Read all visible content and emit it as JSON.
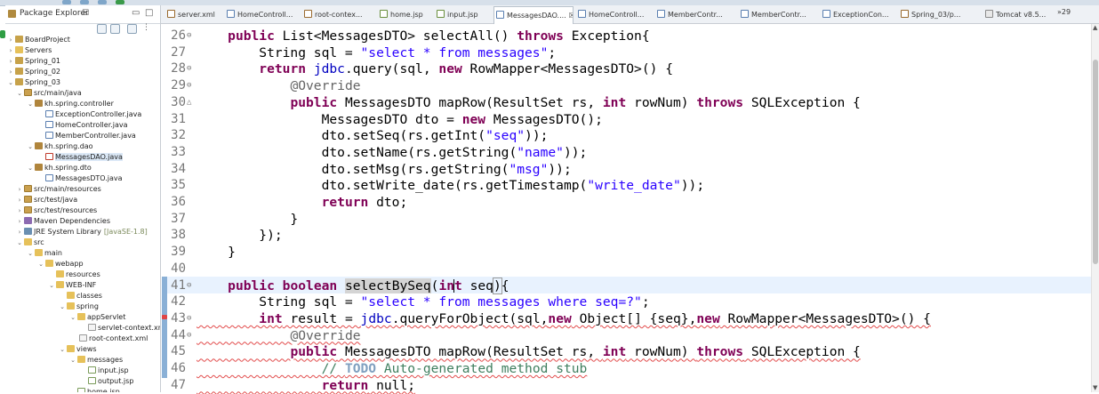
{
  "explorer": {
    "title": "Package Explorer",
    "close_glyph": "☒",
    "tree": [
      {
        "label": "BoardProject",
        "icon": "project-icon",
        "expanded": false
      },
      {
        "label": "Servers",
        "icon": "folder-icon",
        "expanded": false
      },
      {
        "label": "Spring_01",
        "icon": "project-icon",
        "expanded": false
      },
      {
        "label": "Spring_02",
        "icon": "project-icon",
        "expanded": false
      },
      {
        "label": "Spring_03",
        "icon": "project-icon",
        "expanded": true
      },
      {
        "label": "src/main/java",
        "icon": "source-folder-icon",
        "expanded": true
      },
      {
        "label": "kh.spring.controller",
        "icon": "package-icon",
        "expanded": true
      },
      {
        "label": "ExceptionController.java",
        "icon": "java-file-icon"
      },
      {
        "label": "HomeController.java",
        "icon": "java-file-icon"
      },
      {
        "label": "MemberController.java",
        "icon": "java-file-icon"
      },
      {
        "label": "kh.spring.dao",
        "icon": "package-icon",
        "expanded": true
      },
      {
        "label": "MessagesDAO.java",
        "icon": "java-file-icon",
        "selected": true
      },
      {
        "label": "kh.spring.dto",
        "icon": "package-icon",
        "expanded": true
      },
      {
        "label": "MessagesDTO.java",
        "icon": "java-file-icon"
      },
      {
        "label": "src/main/resources",
        "icon": "source-folder-icon",
        "expanded": false
      },
      {
        "label": "src/test/java",
        "icon": "source-folder-icon",
        "expanded": false
      },
      {
        "label": "src/test/resources",
        "icon": "source-folder-icon",
        "expanded": false
      },
      {
        "label": "Maven Dependencies",
        "icon": "library-icon",
        "expanded": false
      },
      {
        "label": "JRE System Library",
        "decoration": "[JavaSE-1.8]",
        "icon": "jre-icon",
        "expanded": false
      },
      {
        "label": "src",
        "icon": "folder-icon",
        "expanded": true
      },
      {
        "label": "main",
        "icon": "folder-icon",
        "expanded": true
      },
      {
        "label": "webapp",
        "icon": "folder-icon",
        "expanded": true
      },
      {
        "label": "resources",
        "icon": "folder-icon"
      },
      {
        "label": "WEB-INF",
        "icon": "folder-icon",
        "expanded": true
      },
      {
        "label": "classes",
        "icon": "folder-icon"
      },
      {
        "label": "spring",
        "icon": "folder-icon",
        "expanded": true
      },
      {
        "label": "appServlet",
        "icon": "folder-icon",
        "expanded": true
      },
      {
        "label": "servlet-context.xn",
        "icon": "xml-file-icon"
      },
      {
        "label": "root-context.xml",
        "icon": "xml-file-icon"
      },
      {
        "label": "views",
        "icon": "folder-icon",
        "expanded": true
      },
      {
        "label": "messages",
        "icon": "folder-icon",
        "expanded": true
      },
      {
        "label": "input.jsp",
        "icon": "jsp-file-icon"
      },
      {
        "label": "output.jsp",
        "icon": "jsp-file-icon"
      },
      {
        "label": "home.jsp",
        "icon": "jsp-file-icon"
      }
    ]
  },
  "tabs": [
    {
      "label": "server.xml",
      "icon": "xml"
    },
    {
      "label": "HomeControll...",
      "icon": "java"
    },
    {
      "label": "root-contex...",
      "icon": "xml"
    },
    {
      "label": "home.jsp",
      "icon": "jsp"
    },
    {
      "label": "input.jsp",
      "icon": "jsp"
    },
    {
      "label": "MessagesDAO....",
      "icon": "java",
      "active": true,
      "close_glyph": "☒"
    },
    {
      "label": "HomeControll...",
      "icon": "java"
    },
    {
      "label": "MemberContr...",
      "icon": "java"
    },
    {
      "label": "MemberContr...",
      "icon": "java"
    },
    {
      "label": "ExceptionCon...",
      "icon": "java"
    },
    {
      "label": "Spring_03/p...",
      "icon": "xml"
    },
    {
      "label": "Tomcat v8.5...",
      "icon": "tomcat"
    }
  ],
  "tab_overflow": "»29",
  "editor": {
    "current_line": 41,
    "lines": [
      {
        "n": 26,
        "fold": "⊖",
        "text": "    public List<MessagesDTO> selectAll() throws Exception{"
      },
      {
        "n": 27,
        "text": "        String sql = \"select * from messages\";"
      },
      {
        "n": 28,
        "fold": "⊖",
        "text": "        return jdbc.query(sql, new RowMapper<MessagesDTO>() {"
      },
      {
        "n": 29,
        "fold": "⊖",
        "text": "            @Override"
      },
      {
        "n": 30,
        "fold": "△",
        "text": "            public MessagesDTO mapRow(ResultSet rs, int rowNum) throws SQLException {"
      },
      {
        "n": 31,
        "text": "                MessagesDTO dto = new MessagesDTO();"
      },
      {
        "n": 32,
        "text": "                dto.setSeq(rs.getInt(\"seq\"));"
      },
      {
        "n": 33,
        "text": "                dto.setName(rs.getString(\"name\"));"
      },
      {
        "n": 34,
        "text": "                dto.setMsg(rs.getString(\"msg\"));"
      },
      {
        "n": 35,
        "text": "                dto.setWrite_date(rs.getTimestamp(\"write_date\"));"
      },
      {
        "n": 36,
        "text": "                return dto;"
      },
      {
        "n": 37,
        "text": "            }"
      },
      {
        "n": 38,
        "text": "        });"
      },
      {
        "n": 39,
        "text": "    }"
      },
      {
        "n": 40,
        "text": ""
      },
      {
        "n": 41,
        "fold": "⊖",
        "text": "    public boolean selectBySeq(int seq){"
      },
      {
        "n": 42,
        "text": "        String sql = \"select * from messages where seq=?\";"
      },
      {
        "n": 43,
        "fold": "⊖",
        "text": "        int result = jdbc.queryForObject(sql,new Object[] {seq},new RowMapper<MessagesDTO>() {"
      },
      {
        "n": 44,
        "fold": "⊖",
        "text": "            @Override"
      },
      {
        "n": 45,
        "text": "            public MessagesDTO mapRow(ResultSet rs, int rowNum) throws SQLException {"
      },
      {
        "n": 46,
        "text": "                // TODO Auto-generated method stub"
      },
      {
        "n": 47,
        "text": "                return null;"
      }
    ]
  }
}
